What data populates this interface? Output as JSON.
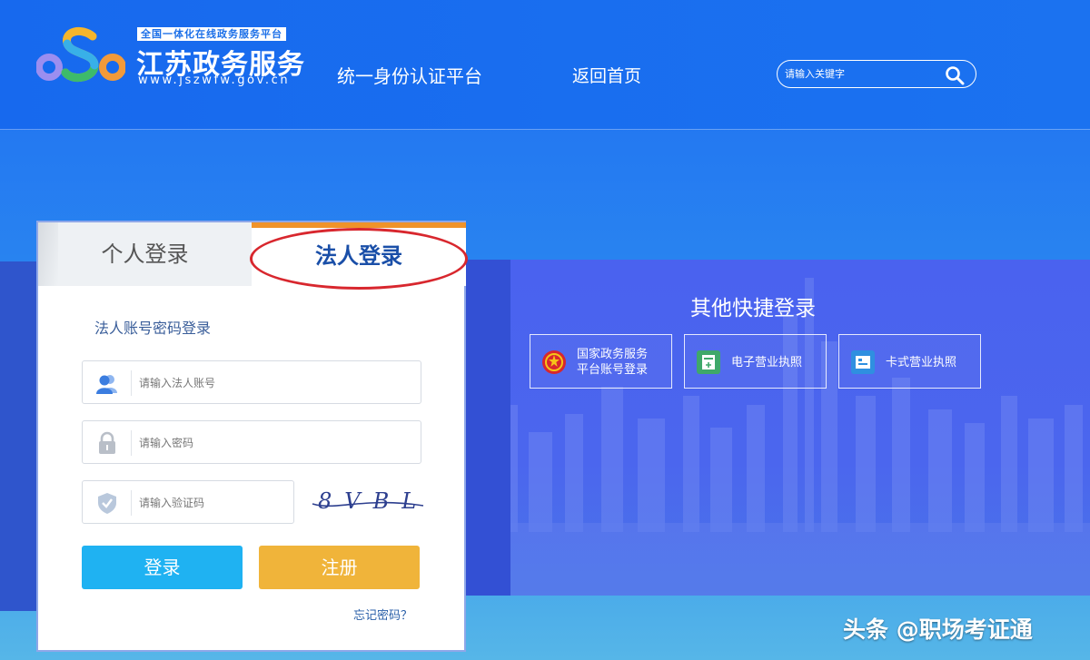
{
  "header": {
    "logo_tag": "全国一体化在线政务服务平台",
    "logo_title": "江苏政务服务",
    "logo_url": "www.jszwfw.gov.cn",
    "platform_title": "统一身份认证平台",
    "home_link": "返回首页",
    "search_placeholder": "请输入关键字"
  },
  "login_card": {
    "tabs": [
      {
        "label": "个人登录",
        "active": false
      },
      {
        "label": "法人登录",
        "active": true
      }
    ],
    "subtitle": "法人账号密码登录",
    "fields": {
      "account_placeholder": "请输入法人账号",
      "password_placeholder": "请输入密码",
      "captcha_placeholder": "请输入验证码"
    },
    "captcha_text": "8VBL",
    "login_button": "登录",
    "register_button": "注册",
    "forgot_password": "忘记密码？"
  },
  "quick_login": {
    "title": "其他快捷登录",
    "options": [
      {
        "label_line1": "国家政务服务",
        "label_line2": "平台账号登录",
        "icon": "national-emblem-icon"
      },
      {
        "label": "电子营业执照",
        "icon": "e-license-icon"
      },
      {
        "label": "卡式营业执照",
        "icon": "card-license-icon"
      }
    ]
  },
  "watermark": "头条 @职场考证通",
  "colors": {
    "header_blue": "#1769ee",
    "active_tab_accent": "#f0932a",
    "login_button": "#1fb2f2",
    "register_button": "#f0b43a",
    "annotation_red": "#d8272e"
  }
}
